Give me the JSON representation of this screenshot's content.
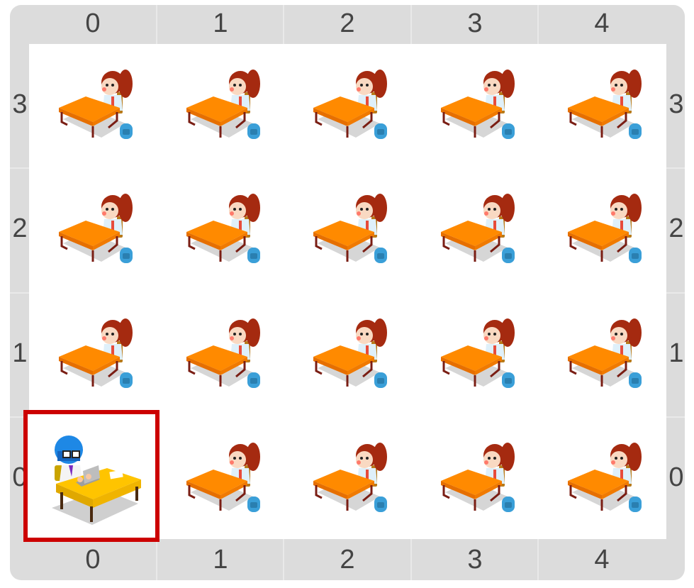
{
  "grid": {
    "columns": [
      "0",
      "1",
      "2",
      "3",
      "4"
    ],
    "rows": [
      "3",
      "2",
      "1",
      "0"
    ],
    "cells": [
      {
        "col": 0,
        "row": "3",
        "kind": "student"
      },
      {
        "col": 1,
        "row": "3",
        "kind": "student"
      },
      {
        "col": 2,
        "row": "3",
        "kind": "student"
      },
      {
        "col": 3,
        "row": "3",
        "kind": "student"
      },
      {
        "col": 4,
        "row": "3",
        "kind": "student"
      },
      {
        "col": 0,
        "row": "2",
        "kind": "student"
      },
      {
        "col": 1,
        "row": "2",
        "kind": "student"
      },
      {
        "col": 2,
        "row": "2",
        "kind": "student"
      },
      {
        "col": 3,
        "row": "2",
        "kind": "student"
      },
      {
        "col": 4,
        "row": "2",
        "kind": "student"
      },
      {
        "col": 0,
        "row": "1",
        "kind": "student"
      },
      {
        "col": 1,
        "row": "1",
        "kind": "student"
      },
      {
        "col": 2,
        "row": "1",
        "kind": "student"
      },
      {
        "col": 3,
        "row": "1",
        "kind": "student"
      },
      {
        "col": 4,
        "row": "1",
        "kind": "student"
      },
      {
        "col": 0,
        "row": "0",
        "kind": "teacher"
      },
      {
        "col": 1,
        "row": "0",
        "kind": "student"
      },
      {
        "col": 2,
        "row": "0",
        "kind": "student"
      },
      {
        "col": 3,
        "row": "0",
        "kind": "student"
      },
      {
        "col": 4,
        "row": "0",
        "kind": "student"
      }
    ]
  },
  "selection": {
    "col": 0,
    "row": "0",
    "color": "#cc0000"
  },
  "colors": {
    "desk": "#ff8a00",
    "teacher_desk": "#ffc400",
    "hair": "#a52a10",
    "backpack": "#3a9fd8",
    "teacher_helmet": "#1e88e5"
  },
  "icons": {
    "student": "student-at-desk-icon",
    "teacher": "teacher-at-desk-icon"
  }
}
